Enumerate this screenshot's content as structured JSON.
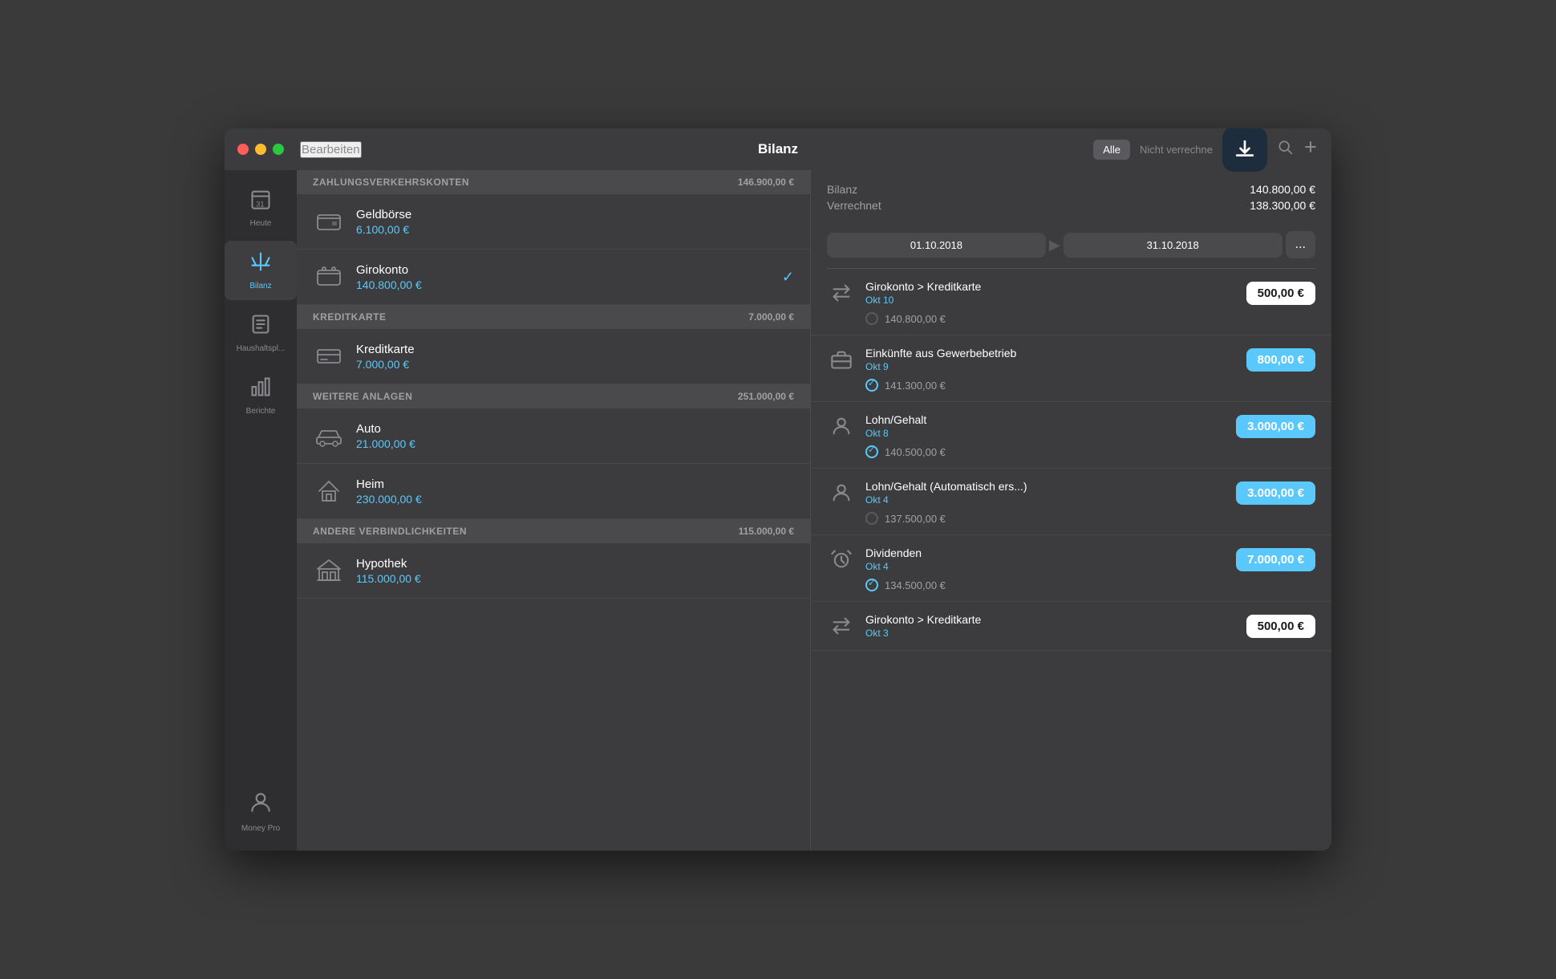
{
  "window": {
    "title": "Bilanz"
  },
  "titlebar": {
    "edit_label": "Bearbeiten",
    "title": "Bilanz",
    "filter_all": "Alle",
    "filter_uncleared": "Nicht verrechne"
  },
  "sidebar": {
    "items": [
      {
        "id": "heute",
        "label": "Heute",
        "icon": "📅"
      },
      {
        "id": "bilanz",
        "label": "Bilanz",
        "icon": "⚖️",
        "active": true
      },
      {
        "id": "haushalt",
        "label": "Haushaltspl...",
        "icon": "🧾"
      },
      {
        "id": "berichte",
        "label": "Berichte",
        "icon": "📊"
      }
    ],
    "bottom": {
      "label": "Money Pro",
      "icon": "👤"
    }
  },
  "accounts": {
    "sections": [
      {
        "id": "zahlungsverkehr",
        "title": "ZAHLUNGSVERKEHRSKONTEN",
        "total": "146.900,00 €",
        "items": [
          {
            "id": "geldboerse",
            "name": "Geldbörse",
            "amount": "6.100,00 €",
            "icon": "wallet",
            "checked": false
          },
          {
            "id": "girokonto",
            "name": "Girokonto",
            "amount": "140.800,00 €",
            "icon": "wallet2",
            "checked": true
          }
        ]
      },
      {
        "id": "kreditkarte",
        "title": "KREDITKARTE",
        "total": "7.000,00 €",
        "items": [
          {
            "id": "kreditkarte",
            "name": "Kreditkarte",
            "amount": "7.000,00 €",
            "icon": "credit",
            "checked": false
          }
        ]
      },
      {
        "id": "weitere",
        "title": "WEITERE ANLAGEN",
        "total": "251.000,00 €",
        "items": [
          {
            "id": "auto",
            "name": "Auto",
            "amount": "21.000,00 €",
            "icon": "car",
            "checked": false
          },
          {
            "id": "heim",
            "name": "Heim",
            "amount": "230.000,00 €",
            "icon": "home",
            "checked": false
          }
        ]
      },
      {
        "id": "verbindlichkeiten",
        "title": "ANDERE VERBINDLICHKEITEN",
        "total": "115.000,00 €",
        "items": [
          {
            "id": "hypothek",
            "name": "Hypothek",
            "amount": "115.000,00 €",
            "icon": "house-bank",
            "checked": false
          }
        ]
      }
    ]
  },
  "transactions": {
    "balance_label": "Bilanz",
    "balance_value": "140.800,00 €",
    "cleared_label": "Verrechnet",
    "cleared_value": "138.300,00 €",
    "date_from": "01.10.2018",
    "date_to": "31.10.2018",
    "more_label": "...",
    "items": [
      {
        "id": "tx1",
        "name": "Girokonto > Kreditkarte",
        "date": "Okt 10",
        "amount": "500,00 €",
        "amount_style": "static",
        "running_balance": "140.800,00 €",
        "status": "unchecked",
        "icon": "transfer"
      },
      {
        "id": "tx2",
        "name": "Einkünfte aus Gewerbebetrieb",
        "date": "Okt 9",
        "amount": "800,00 €",
        "amount_style": "teal",
        "running_balance": "141.300,00 €",
        "status": "checked",
        "icon": "briefcase"
      },
      {
        "id": "tx3",
        "name": "Lohn/Gehalt",
        "date": "Okt 8",
        "amount": "3.000,00 €",
        "amount_style": "teal",
        "running_balance": "140.500,00 €",
        "status": "checked",
        "icon": "person"
      },
      {
        "id": "tx4",
        "name": "Lohn/Gehalt (Automatisch ers...)",
        "date": "Okt 4",
        "amount": "3.000,00 €",
        "amount_style": "teal",
        "running_balance": "137.500,00 €",
        "status": "unchecked",
        "icon": "person"
      },
      {
        "id": "tx5",
        "name": "Dividenden",
        "date": "Okt 4",
        "amount": "7.000,00 €",
        "amount_style": "teal",
        "running_balance": "134.500,00 €",
        "status": "checked",
        "icon": "alarm"
      },
      {
        "id": "tx6",
        "name": "Girokonto > Kreditkarte",
        "date": "Okt 3",
        "amount": "500,00 €",
        "amount_style": "static",
        "running_balance": "",
        "status": "unchecked",
        "icon": "transfer"
      }
    ]
  }
}
